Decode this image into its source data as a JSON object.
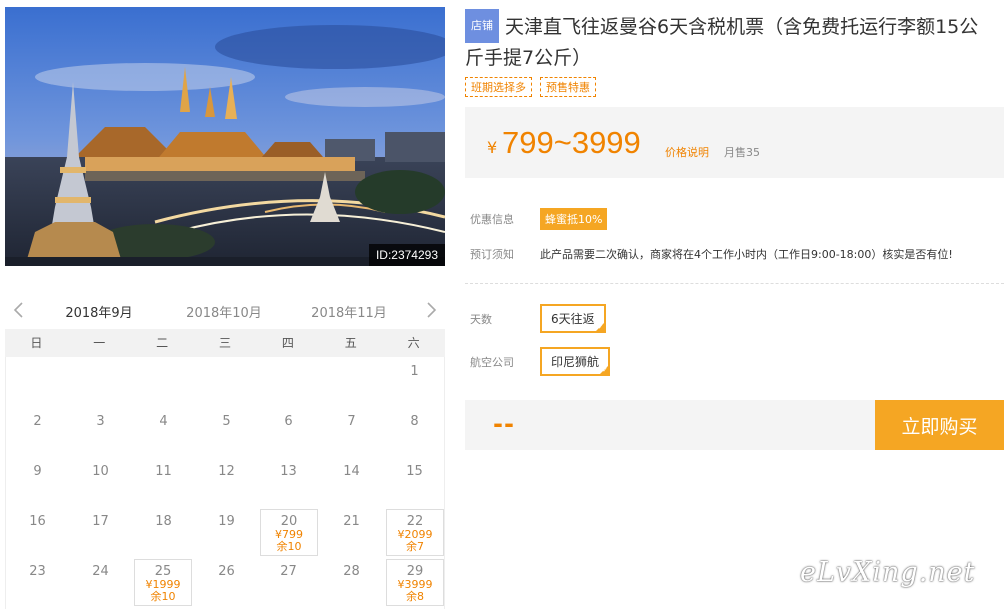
{
  "hero": {
    "image_id": "ID:2374293",
    "alt": "曼谷大皇宫夜景"
  },
  "calendar": {
    "months": [
      "2018年9月",
      "2018年10月",
      "2018年11月"
    ],
    "active_month": 0,
    "weekdays": [
      "日",
      "一",
      "二",
      "三",
      "四",
      "五",
      "六"
    ],
    "days": [
      {
        "day": "1",
        "price": "",
        "stock": ""
      },
      {
        "day": "2",
        "price": "",
        "stock": ""
      },
      {
        "day": "3",
        "price": "",
        "stock": ""
      },
      {
        "day": "4",
        "price": "",
        "stock": ""
      },
      {
        "day": "5",
        "price": "",
        "stock": ""
      },
      {
        "day": "6",
        "price": "",
        "stock": ""
      },
      {
        "day": "7",
        "price": "",
        "stock": ""
      },
      {
        "day": "8",
        "price": "",
        "stock": ""
      },
      {
        "day": "9",
        "price": "",
        "stock": ""
      },
      {
        "day": "10",
        "price": "",
        "stock": ""
      },
      {
        "day": "11",
        "price": "",
        "stock": ""
      },
      {
        "day": "12",
        "price": "",
        "stock": ""
      },
      {
        "day": "13",
        "price": "",
        "stock": ""
      },
      {
        "day": "14",
        "price": "",
        "stock": ""
      },
      {
        "day": "15",
        "price": "",
        "stock": ""
      },
      {
        "day": "16",
        "price": "",
        "stock": ""
      },
      {
        "day": "17",
        "price": "",
        "stock": ""
      },
      {
        "day": "18",
        "price": "",
        "stock": ""
      },
      {
        "day": "19",
        "price": "",
        "stock": ""
      },
      {
        "day": "20",
        "price": "¥799",
        "stock": "余10"
      },
      {
        "day": "21",
        "price": "",
        "stock": ""
      },
      {
        "day": "22",
        "price": "¥2099",
        "stock": "余7"
      },
      {
        "day": "23",
        "price": "",
        "stock": ""
      },
      {
        "day": "24",
        "price": "",
        "stock": ""
      },
      {
        "day": "25",
        "price": "¥1999",
        "stock": "余10"
      },
      {
        "day": "26",
        "price": "",
        "stock": ""
      },
      {
        "day": "27",
        "price": "",
        "stock": ""
      },
      {
        "day": "28",
        "price": "",
        "stock": ""
      },
      {
        "day": "29",
        "price": "¥3999",
        "stock": "余8"
      }
    ]
  },
  "product": {
    "shop_tag": "店铺",
    "title": "天津直飞往返曼谷6天含税机票（含免费托运行李额15公斤手提7公斤）",
    "tags": [
      "班期选择多",
      "预售特惠"
    ],
    "price_yen": "¥",
    "price_range": "799~3999",
    "price_note": "价格说明",
    "monthly_sales": "月售35"
  },
  "info": {
    "promo_label": "优惠信息",
    "promo_badge": "蜂蜜抵10%",
    "notice_label": "预订须知",
    "notice_text": "此产品需要二次确认，商家将在4个工作小时内（工作日9:00-18:00）核实是否有位!"
  },
  "options": {
    "days_label": "天数",
    "days_value": "6天往返",
    "airline_label": "航空公司",
    "airline_value": "印尼狮航"
  },
  "purchase": {
    "total": "--",
    "buy_label": "立即购买"
  },
  "watermark": "eLvXing.net",
  "colors": {
    "accent": "#f5a623",
    "price": "#f08300",
    "shop_tag": "#6e8fe0"
  }
}
